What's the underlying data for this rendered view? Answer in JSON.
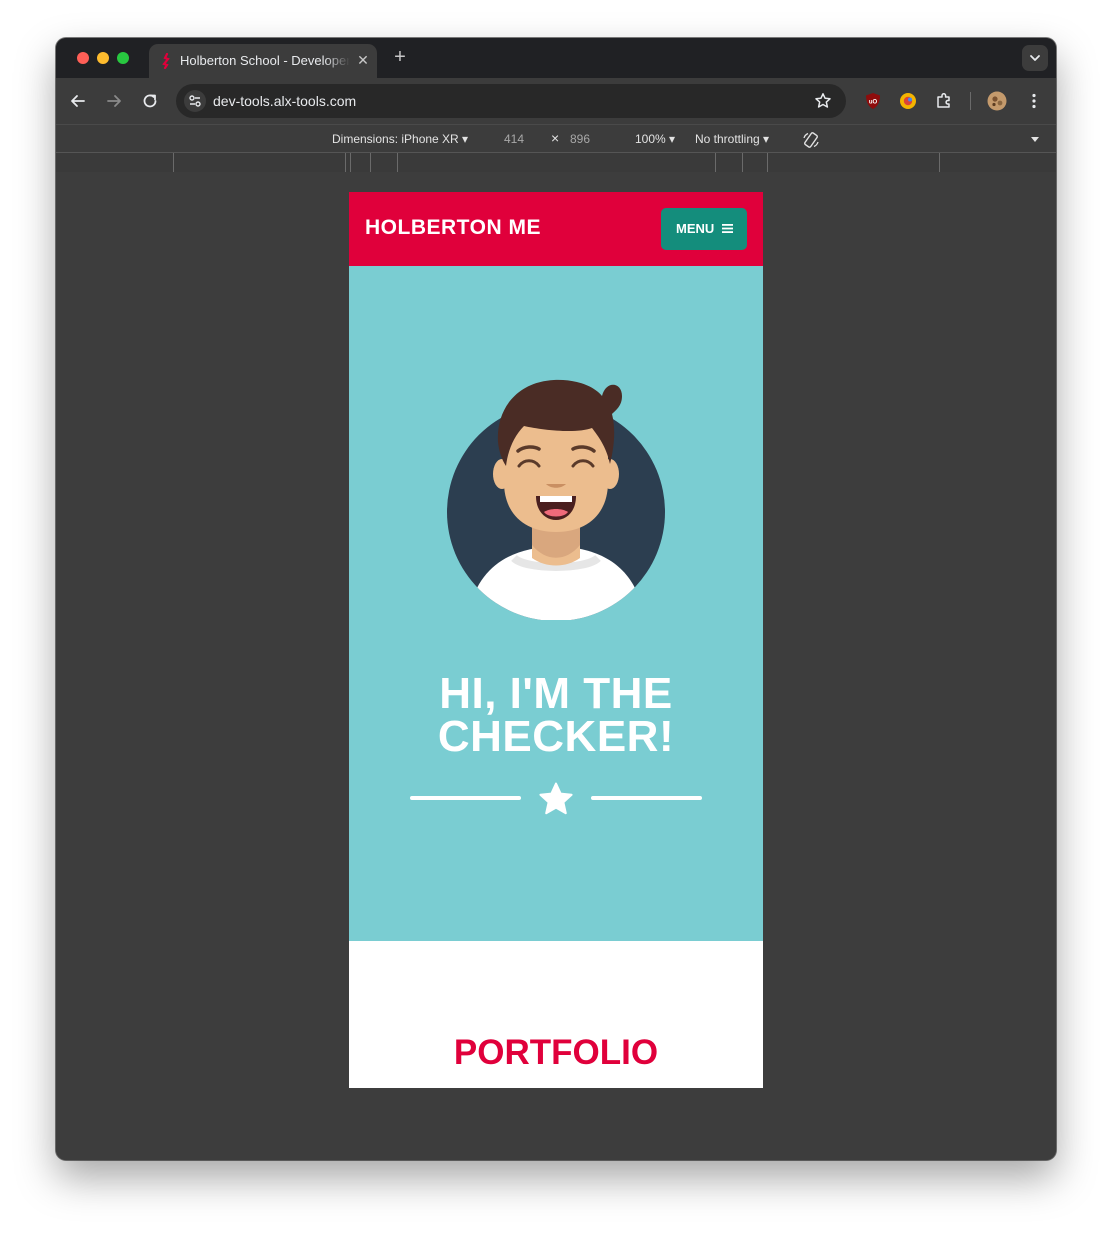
{
  "browser": {
    "tab_title": "Holberton School - Developer Tools",
    "tab_close": "✕",
    "new_tab": "+",
    "url": "dev-tools.alx-tools.com"
  },
  "device_toolbar": {
    "dimensions_label": "Dimensions: iPhone XR ▾",
    "width": "414",
    "times": "×",
    "height": "896",
    "zoom": "100% ▾",
    "throttling": "No throttling ▾"
  },
  "site": {
    "brand": "HOLBERTON ME",
    "menu_label": "MENU",
    "hero_title": "HI, I'M THE CHECKER!",
    "portfolio_title": "PORTFOLIO"
  },
  "colors": {
    "header_red": "#e0003b",
    "menu_teal": "#148d7c",
    "hero_cyan": "#7acdd2"
  }
}
